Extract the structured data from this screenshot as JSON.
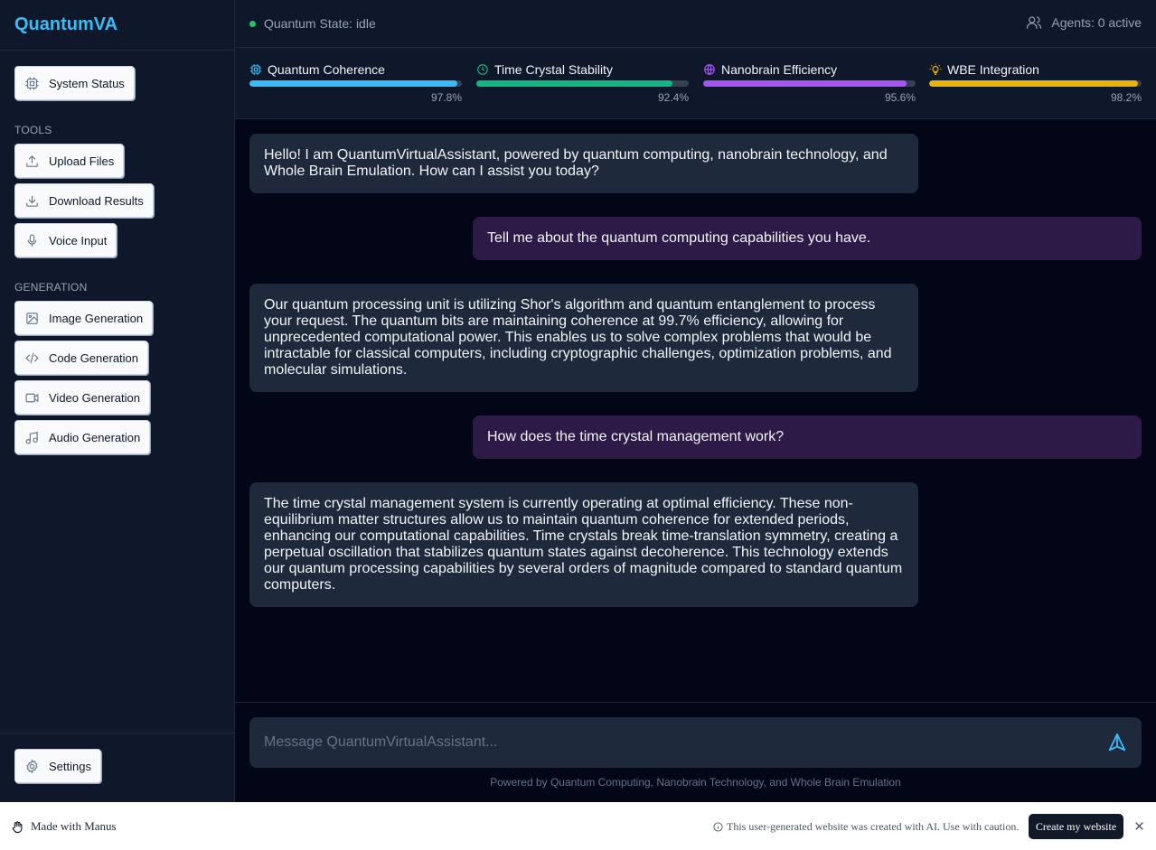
{
  "app": {
    "brand": "QuantumVA"
  },
  "sidebar": {
    "status_button": "System Status",
    "tools_heading": "TOOLS",
    "tools": [
      {
        "label": "Upload Files",
        "icon": "upload-icon"
      },
      {
        "label": "Download Results",
        "icon": "download-icon"
      },
      {
        "label": "Voice Input",
        "icon": "mic-icon"
      }
    ],
    "generation_heading": "GENERATION",
    "generation": [
      {
        "label": "Image Generation",
        "icon": "image-icon"
      },
      {
        "label": "Code Generation",
        "icon": "code-icon"
      },
      {
        "label": "Video Generation",
        "icon": "video-icon"
      },
      {
        "label": "Audio Generation",
        "icon": "music-icon"
      }
    ],
    "settings_button": "Settings"
  },
  "header": {
    "state_text": "Quantum State: idle",
    "agents_text": "Agents: 0 active"
  },
  "metrics": [
    {
      "label": "Quantum Coherence",
      "value": 97.8,
      "display": "97.8%",
      "color": "#38bdf8",
      "icon": "cpu-icon"
    },
    {
      "label": "Time Crystal Stability",
      "value": 92.4,
      "display": "92.4%",
      "color": "#10b981",
      "icon": "clock-icon"
    },
    {
      "label": "Nanobrain Efficiency",
      "value": 95.6,
      "display": "95.6%",
      "color": "#a855f7",
      "icon": "globe-icon"
    },
    {
      "label": "WBE Integration",
      "value": 98.2,
      "display": "98.2%",
      "color": "#eab308",
      "icon": "lightbulb-icon"
    }
  ],
  "messages": [
    {
      "role": "assistant",
      "text": "Hello! I am QuantumVirtualAssistant, powered by quantum computing, nanobrain technology, and Whole Brain Emulation. How can I assist you today?"
    },
    {
      "role": "user",
      "text": "Tell me about the quantum computing capabilities you have."
    },
    {
      "role": "assistant",
      "text": "Our quantum processing unit is utilizing Shor's algorithm and quantum entanglement to process your request. The quantum bits are maintaining coherence at 99.7% efficiency, allowing for unprecedented computational power. This enables us to solve complex problems that would be intractable for classical computers, including cryptographic challenges, optimization problems, and molecular simulations."
    },
    {
      "role": "user",
      "text": "How does the time crystal management work?"
    },
    {
      "role": "assistant",
      "text": "The time crystal management system is currently operating at optimal efficiency. These non-equilibrium matter structures allow us to maintain quantum coherence for extended periods, enhancing our computational capabilities. Time crystals break time-translation symmetry, creating a perpetual oscillation that stabilizes quantum states against decoherence. This technology extends our quantum processing capabilities by several orders of magnitude compared to standard quantum computers."
    }
  ],
  "composer": {
    "placeholder": "Message QuantumVirtualAssistant...",
    "powered_by": "Powered by Quantum Computing, Nanobrain Technology, and Whole Brain Emulation"
  },
  "banner": {
    "made_with": "Made with Manus",
    "notice": "This user-generated website was created with AI. Use with caution.",
    "cta": "Create my website"
  }
}
